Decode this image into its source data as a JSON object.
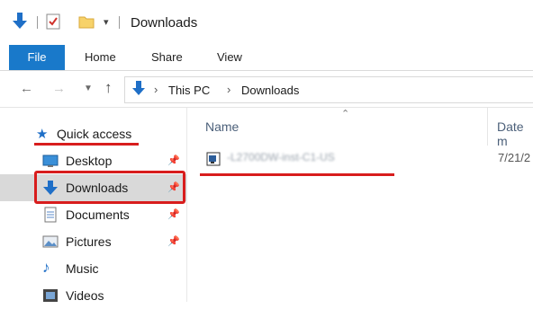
{
  "window": {
    "title": "Downloads"
  },
  "ribbon": {
    "tabs": [
      {
        "label": "File"
      },
      {
        "label": "Home"
      },
      {
        "label": "Share"
      },
      {
        "label": "View"
      }
    ]
  },
  "address": {
    "crumbs": [
      "This PC",
      "Downloads"
    ]
  },
  "nav": {
    "quick_access": "Quick access",
    "items": [
      {
        "label": "Desktop",
        "icon": "desktop-icon",
        "pinned": true
      },
      {
        "label": "Downloads",
        "icon": "downloads-icon",
        "pinned": true,
        "selected": true
      },
      {
        "label": "Documents",
        "icon": "documents-icon",
        "pinned": true
      },
      {
        "label": "Pictures",
        "icon": "pictures-icon",
        "pinned": true
      },
      {
        "label": "Music",
        "icon": "music-icon",
        "pinned": false
      },
      {
        "label": "Videos",
        "icon": "videos-icon",
        "pinned": false
      }
    ]
  },
  "files": {
    "columns": {
      "name": "Name",
      "date": "Date m"
    },
    "rows": [
      {
        "name": "-L2700DW-inst-C1-US",
        "name_blurred": true,
        "date": "7/21/2"
      }
    ]
  },
  "annotations": {
    "highlight_color": "#d81d1d"
  },
  "colors": {
    "accent": "#1979ca",
    "selected_bg": "#d9d9d9"
  }
}
